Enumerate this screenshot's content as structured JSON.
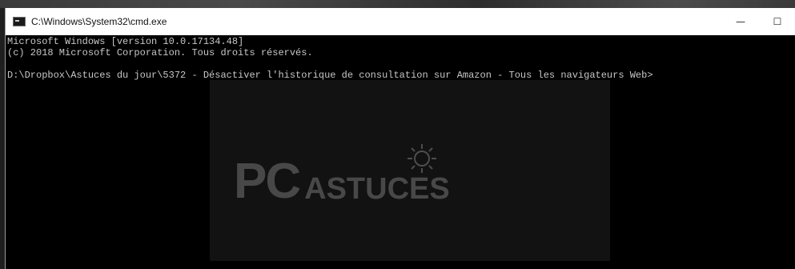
{
  "window": {
    "title": "C:\\Windows\\System32\\cmd.exe",
    "controls": {
      "minimize": "—",
      "maximize": "☐"
    }
  },
  "console": {
    "lines": [
      "Microsoft Windows [version 10.0.17134.48]",
      "(c) 2018 Microsoft Corporation. Tous droits réservés.",
      "",
      "D:\\Dropbox\\Astuces du jour\\5372 - Désactiver l'historique de consultation sur Amazon - Tous les navigateurs Web>"
    ]
  },
  "watermark": {
    "pc": "PC",
    "astuces": "ASTUCES"
  },
  "colors": {
    "console_bg": "#000000",
    "console_text": "#c7c7c7",
    "titlebar_bg": "#ffffff"
  }
}
